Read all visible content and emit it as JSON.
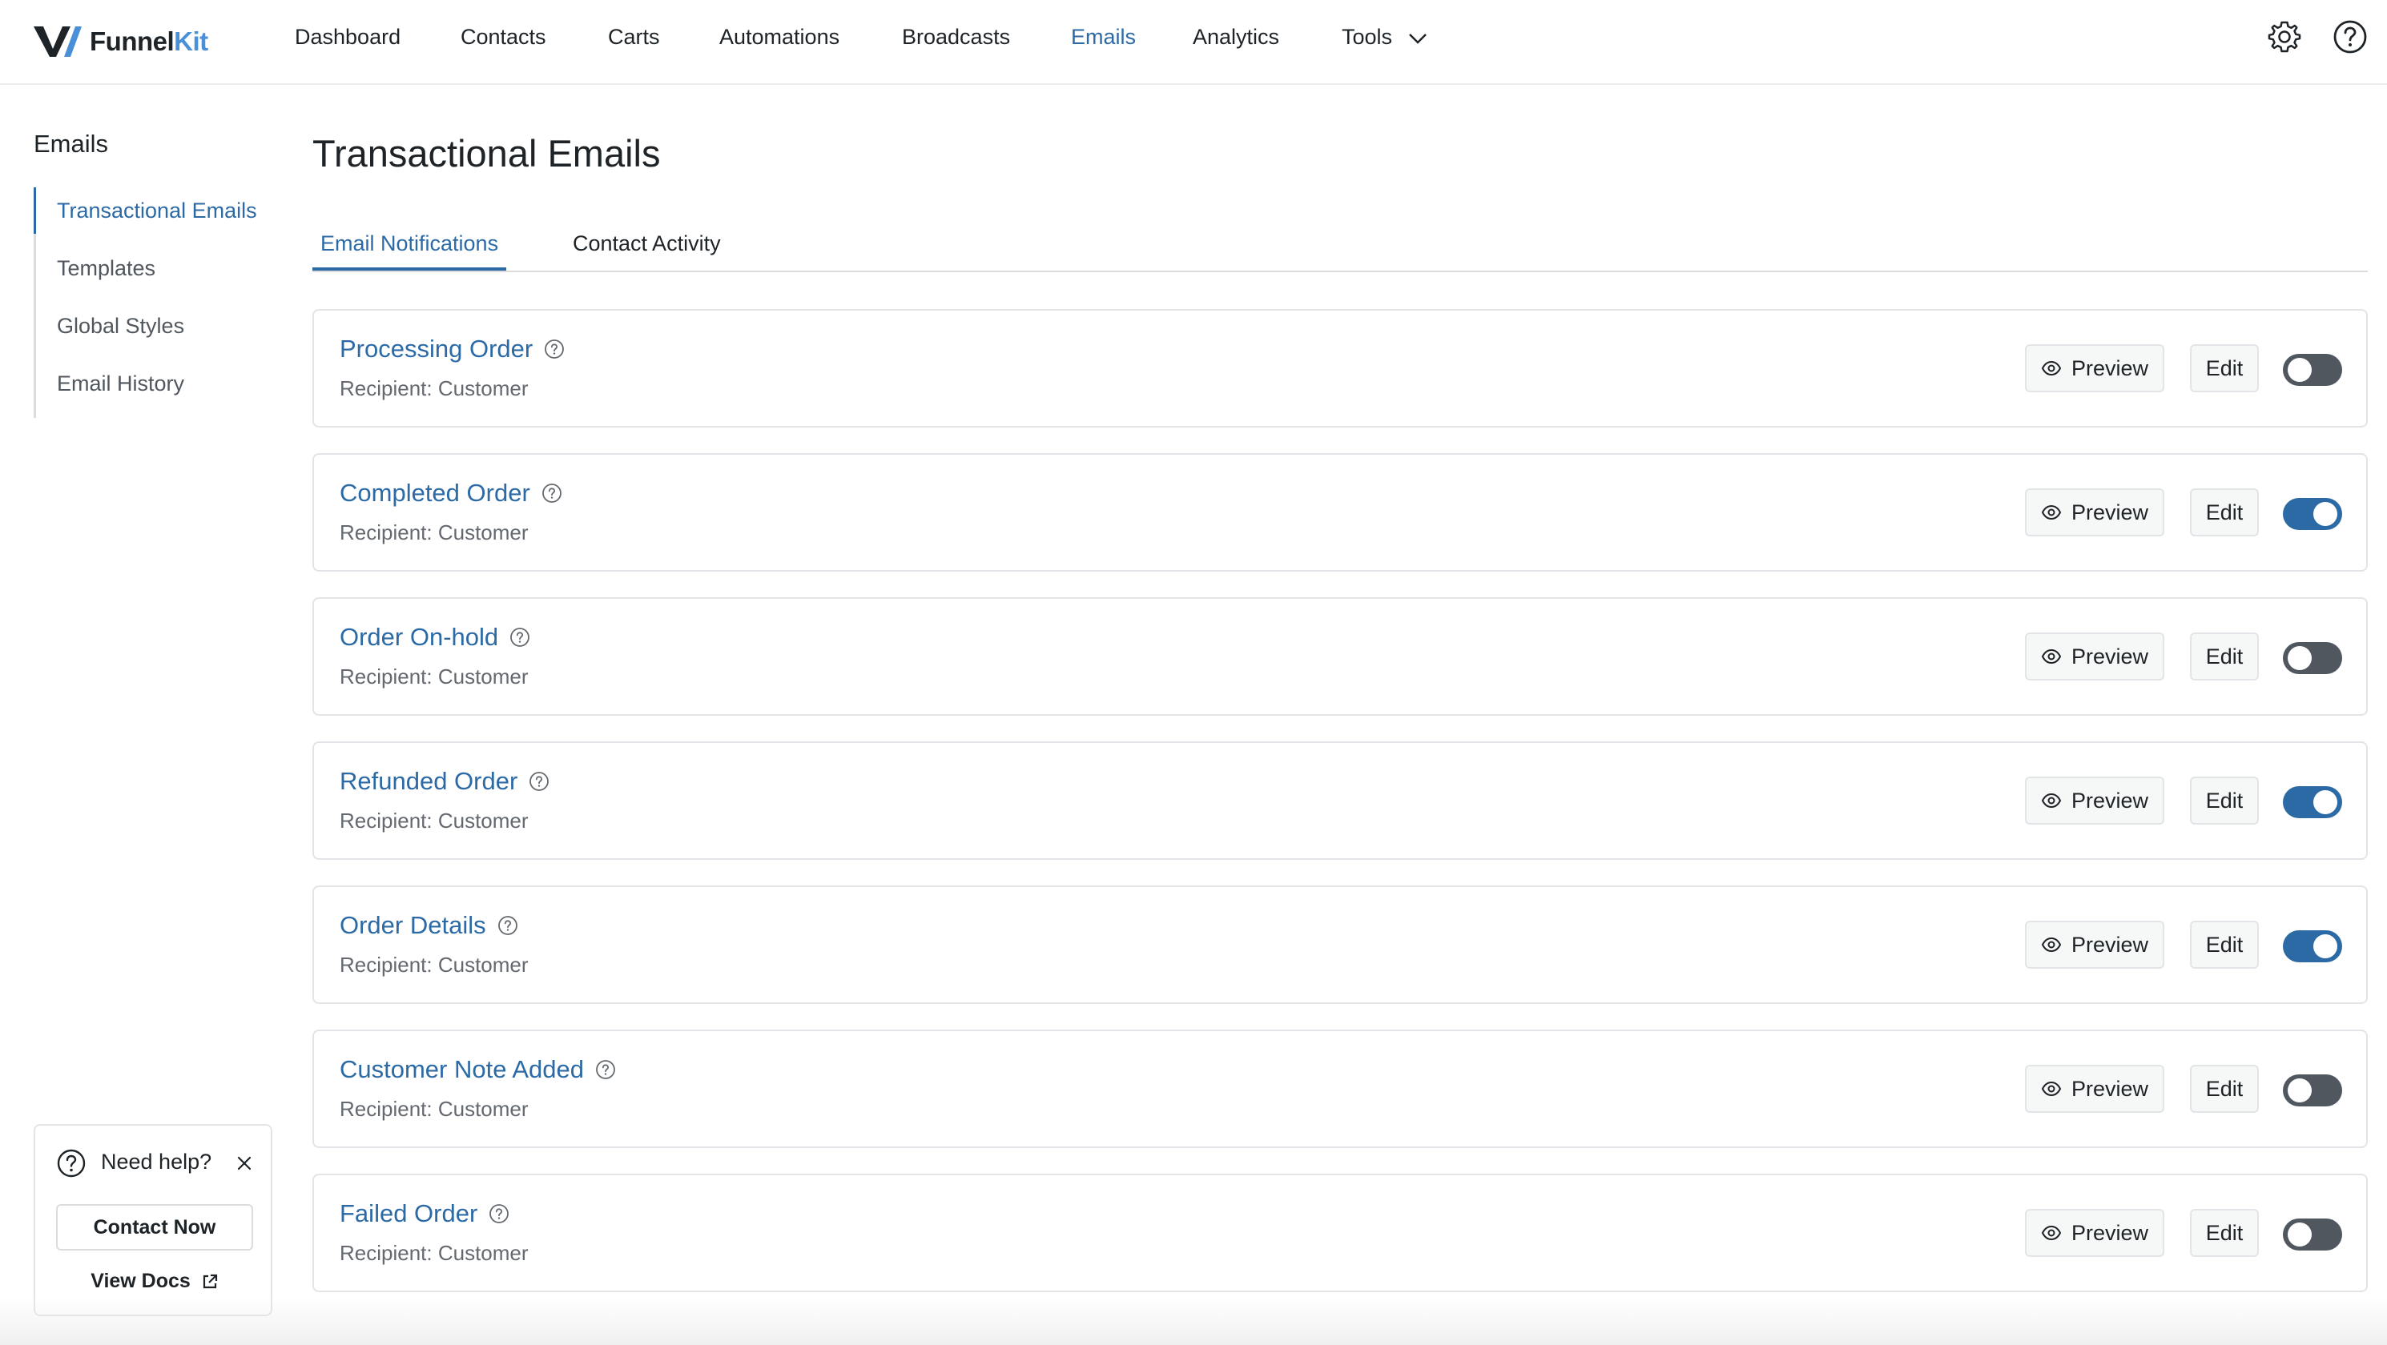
{
  "brand": {
    "name_part1": "Funnel",
    "name_part2": "Kit",
    "accent": "#2c6aa5"
  },
  "nav": {
    "items": [
      {
        "label": "Dashboard",
        "active": false
      },
      {
        "label": "Contacts",
        "active": false
      },
      {
        "label": "Carts",
        "active": false
      },
      {
        "label": "Automations",
        "active": false
      },
      {
        "label": "Broadcasts",
        "active": false
      },
      {
        "label": "Emails",
        "active": true
      },
      {
        "label": "Analytics",
        "active": false
      },
      {
        "label": "Tools",
        "active": false
      }
    ],
    "icons": [
      "gear-icon",
      "help-icon"
    ]
  },
  "sidebar": {
    "title": "Emails",
    "items": [
      {
        "label": "Transactional Emails",
        "active": true
      },
      {
        "label": "Templates",
        "active": false
      },
      {
        "label": "Global Styles",
        "active": false
      },
      {
        "label": "Email History",
        "active": false
      }
    ]
  },
  "help": {
    "title": "Need help?",
    "contact_label": "Contact Now",
    "docs_label": "View Docs"
  },
  "main": {
    "title": "Transactional Emails",
    "tabs": [
      {
        "label": "Email Notifications",
        "active": true
      },
      {
        "label": "Contact Activity",
        "active": false
      }
    ],
    "preview_label": "Preview",
    "edit_label": "Edit",
    "emails": [
      {
        "name": "Processing Order",
        "recipient": "Recipient: Customer",
        "enabled": false
      },
      {
        "name": "Completed Order",
        "recipient": "Recipient: Customer",
        "enabled": true
      },
      {
        "name": "Order On-hold",
        "recipient": "Recipient: Customer",
        "enabled": false
      },
      {
        "name": "Refunded Order",
        "recipient": "Recipient: Customer",
        "enabled": true
      },
      {
        "name": "Order Details",
        "recipient": "Recipient: Customer",
        "enabled": true
      },
      {
        "name": "Customer Note Added",
        "recipient": "Recipient: Customer",
        "enabled": false
      },
      {
        "name": "Failed Order",
        "recipient": "Recipient: Customer",
        "enabled": false
      }
    ]
  }
}
